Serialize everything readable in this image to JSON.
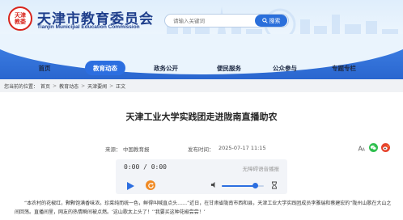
{
  "header": {
    "logo_lines": [
      "天津",
      "教委"
    ],
    "site_name_cn": "天津市教育委员会",
    "site_name_en": "Tianjin Municipal Education Commission",
    "search_placeholder": "请输入关键词",
    "search_button": "搜索"
  },
  "nav": {
    "items": [
      {
        "label": "首页",
        "active": false
      },
      {
        "label": "教育动态",
        "active": true
      },
      {
        "label": "政务公开",
        "active": false
      },
      {
        "label": "便民服务",
        "active": false
      },
      {
        "label": "公众参与",
        "active": false
      },
      {
        "label": "专题专栏",
        "active": false
      }
    ]
  },
  "breadcrumb": {
    "prefix": "您当前的位置：",
    "items": [
      "首页",
      "教育动态",
      "天津要闻",
      "正文"
    ],
    "separator": ">"
  },
  "article": {
    "title": "天津工业大学实践团走进陇南直播助农",
    "source_label": "来源：",
    "source_value": "中国教育报",
    "date_label": "发布时间：",
    "date_value": "2025-07-17 11:15",
    "body": "“本农村的花椒红，颗颗饱满香味浓。珍菜纯而统一色，鲜得叫喊直点头……”近日，在甘肃省陇南市西和县，天津工业大学实践团成员李雅瑞和蔡建宏的“陇州山歌在大山之间回荡。直播间里，网友的热情瞬间被点燃。‘这山歌太上头了！’‘我要买这种花椒尝尝！’"
  },
  "audio": {
    "time": "0:00 / 0:00",
    "accessibility_label": "无障碍语音播报",
    "volume_level": 0.78,
    "rate_icon": "hourglass-icon"
  },
  "colors": {
    "brand_blue": "#1f3f8c",
    "nav_blue": "#2c6ee0",
    "logo_red": "#d8241c",
    "accent_orange": "#f08a24"
  }
}
